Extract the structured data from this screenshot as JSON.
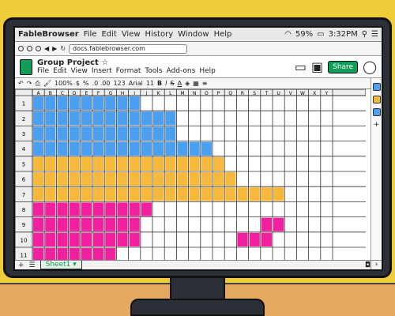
{
  "os": {
    "app_name": "FableBrowser",
    "menus": [
      "File",
      "Edit",
      "View",
      "History",
      "Window",
      "Help"
    ],
    "battery": "59%",
    "time": "3:32PM"
  },
  "browser": {
    "url": "docs.fablebrowser.com"
  },
  "doc": {
    "title": "Group Project",
    "star": "☆",
    "menus": [
      "File",
      "Edit",
      "View",
      "Insert",
      "Format",
      "Tools",
      "Add-ons",
      "Help"
    ],
    "share_label": "Share"
  },
  "toolbar": {
    "zoom": "100%",
    "currency": "$",
    "percent": "%",
    "decimals": ".0 .00",
    "format": "123",
    "font": "Arial",
    "font_size": "11",
    "bold": "B",
    "italic": "I",
    "strike": "S",
    "underline": "A"
  },
  "sheet": {
    "tab_label": "Sheet1",
    "columns": [
      "A",
      "B",
      "C",
      "D",
      "E",
      "F",
      "G",
      "H",
      "I",
      "J",
      "K",
      "L",
      "M",
      "N",
      "O",
      "P",
      "Q",
      "R",
      "S",
      "T",
      "U",
      "V",
      "W",
      "X",
      "Y"
    ],
    "rows": [
      "1",
      "2",
      "3",
      "4",
      "5",
      "6",
      "7",
      "8",
      "9",
      "10",
      "11"
    ],
    "colors": {
      "blue": "#4a9ff0",
      "orange": "#f6b93b",
      "pink": "#f0209e",
      "green": "#0f9d58"
    },
    "filled_cells": [
      {
        "row": 1,
        "from": 0,
        "to": 8,
        "color": "blue"
      },
      {
        "row": 2,
        "from": 0,
        "to": 11,
        "color": "blue"
      },
      {
        "row": 3,
        "from": 0,
        "to": 11,
        "color": "blue"
      },
      {
        "row": 4,
        "from": 0,
        "to": 14,
        "color": "blue"
      },
      {
        "row": 5,
        "from": 0,
        "to": 15,
        "color": "orange"
      },
      {
        "row": 6,
        "from": 0,
        "to": 16,
        "color": "orange"
      },
      {
        "row": 7,
        "from": 0,
        "to": 20,
        "color": "orange"
      },
      {
        "row": 8,
        "from": 0,
        "to": 9,
        "color": "pink"
      },
      {
        "row": 9,
        "from": 0,
        "to": 8,
        "color": "pink"
      },
      {
        "row": 9,
        "from": 19,
        "to": 20,
        "color": "pink"
      },
      {
        "row": 10,
        "from": 0,
        "to": 8,
        "color": "pink"
      },
      {
        "row": 10,
        "from": 17,
        "to": 19,
        "color": "pink"
      },
      {
        "row": 11,
        "from": 0,
        "to": 6,
        "color": "pink"
      }
    ]
  }
}
